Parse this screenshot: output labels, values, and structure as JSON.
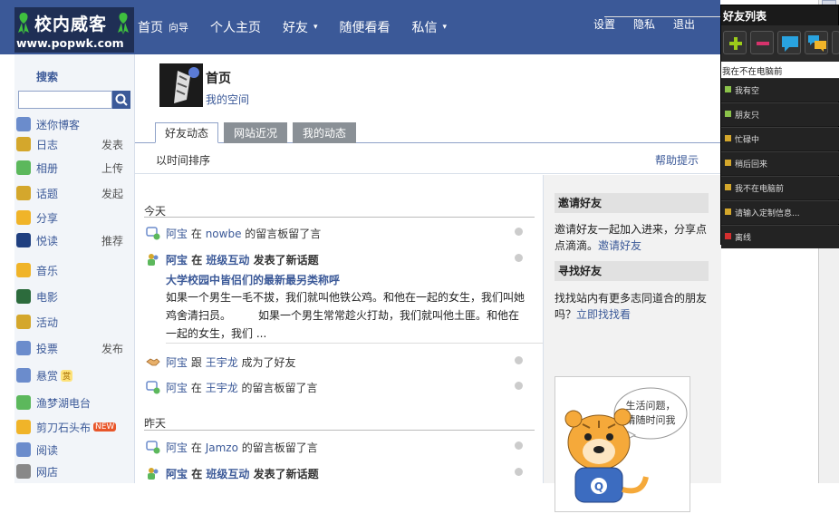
{
  "logo": {
    "name": "校内威客",
    "url": "www.popwk.com"
  },
  "nav": {
    "items": [
      {
        "label": "首页",
        "sub": "向导"
      },
      {
        "label": "个人主页"
      },
      {
        "label": "好友",
        "caret": "▾"
      },
      {
        "label": "随便看看"
      },
      {
        "label": "私信",
        "caret": "▾"
      }
    ],
    "right": [
      "设置",
      "隐私",
      "退出"
    ]
  },
  "sidebar": {
    "search_title": "搜索",
    "items": [
      {
        "label": "迷你博客",
        "right": "",
        "icon": "chat-icon"
      },
      {
        "label": "日志",
        "right": "发表",
        "icon": "diary-icon"
      },
      {
        "label": "相册",
        "right": "上传",
        "icon": "photo-icon"
      },
      {
        "label": "话题",
        "right": "发起",
        "icon": "people-icon"
      },
      {
        "label": "分享",
        "right": "",
        "icon": "folder-icon"
      },
      {
        "label": "悦读",
        "right": "推荐",
        "icon": "read-icon"
      },
      {
        "label": "音乐",
        "right": "",
        "icon": "music-icon"
      },
      {
        "label": "电影",
        "right": "",
        "icon": "film-icon"
      },
      {
        "label": "活动",
        "right": "",
        "icon": "activity-icon"
      },
      {
        "label": "投票",
        "right": "发布",
        "icon": "vote-icon"
      },
      {
        "label": "悬赏",
        "right": "",
        "badge": "赏",
        "icon": "reward-icon"
      },
      {
        "label": "渔梦湖电台",
        "right": "",
        "icon": "radio-icon"
      },
      {
        "label": "剪刀石头布",
        "right": "",
        "badge": "NEW",
        "icon": "game-icon"
      },
      {
        "label": "阅读",
        "right": "",
        "icon": "reading-icon"
      },
      {
        "label": "网店",
        "right": "",
        "icon": "shop-icon"
      }
    ]
  },
  "profile": {
    "title": "首页",
    "space": "我的空间"
  },
  "tabs": [
    {
      "label": "好友动态",
      "active": true
    },
    {
      "label": "网站近况"
    },
    {
      "label": "我的动态"
    }
  ],
  "sortbar": {
    "left": "以时间排序",
    "right": "帮助提示"
  },
  "feed": {
    "today": "今天",
    "yesterday": "昨天",
    "items": [
      {
        "user": "阿宝",
        "pre": "在",
        "link": "nowbe",
        "post": "的留言板留了言"
      },
      {
        "user": "阿宝",
        "pre": "在",
        "link": "班级互动",
        "post": "发表了新话题",
        "title": "大学校园中皆侣们的最新最另类称呼",
        "body": "如果一个男生一毛不拔，我们就叫他铁公鸡。和他在一起的女生，我们叫她鸡舍清扫员。　　　如果一个男生常常趁火打劫，我们就叫他土匪。和他在一起的女生，我们 ..."
      },
      {
        "user": "阿宝",
        "pre": "跟",
        "link": "王宇龙",
        "post": "成为了好友"
      },
      {
        "user": "阿宝",
        "pre": "在",
        "link": "王宇龙",
        "post": "的留言板留了言"
      },
      {
        "user": "阿宝",
        "pre": "在",
        "link": "Jamzo",
        "post": "的留言板留了言"
      },
      {
        "user": "阿宝",
        "pre": "在",
        "link": "班级互动",
        "post": "发表了新话题"
      }
    ]
  },
  "right": {
    "invite_title": "邀请好友",
    "invite_text": "邀请好友一起加入进来，分享点点滴滴。",
    "invite_link": "邀请好友",
    "find_title": "寻找好友",
    "find_text": "找找站内有更多志同道合的朋友吗？",
    "find_link": "立即找找看",
    "bubble": "生活问题，请随时问我"
  },
  "friends_panel": {
    "title": "好友列表",
    "current": "我在不在电脑前",
    "statuses": [
      {
        "label": "我有空",
        "color": "#8bc34a"
      },
      {
        "label": "朋友只",
        "color": "#8bc34a"
      },
      {
        "label": "忙碌中",
        "color": "#d4a72c"
      },
      {
        "label": "稍后回来",
        "color": "#d4a72c"
      },
      {
        "label": "我不在电脑前",
        "color": "#d4a72c"
      },
      {
        "label": "请输入定制信息...",
        "color": "#d4a72c"
      },
      {
        "label": "离线",
        "color": "#d32f2f"
      }
    ]
  }
}
